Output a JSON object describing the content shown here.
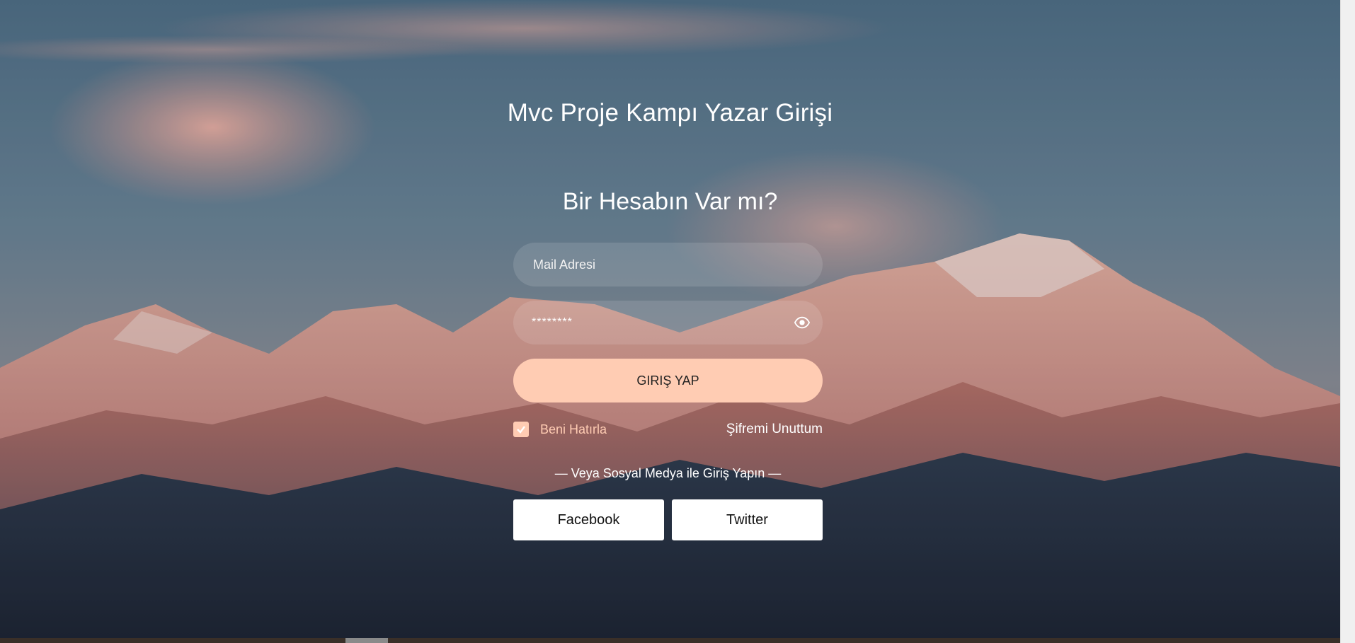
{
  "page": {
    "title": "Mvc Proje Kampı Yazar Girişi",
    "subtitle": "Bir Hesabın Var mı?"
  },
  "form": {
    "email_placeholder": "Mail Adresi",
    "password_value": "********",
    "login_label": "GIRIŞ YAP",
    "remember_label": "Beni Hatırla",
    "remember_checked": true,
    "forgot_label": "Şifremi Unuttum",
    "divider_text": "— Veya Sosyal Medya ile Giriş Yapın —",
    "facebook_label": "Facebook",
    "twitter_label": "Twitter"
  },
  "icons": {
    "password_toggle": "eye-icon",
    "remember_check": "check-icon"
  },
  "colors": {
    "accent": "#ffccb3",
    "text": "#ffffff",
    "sky": "#5f7c90"
  }
}
